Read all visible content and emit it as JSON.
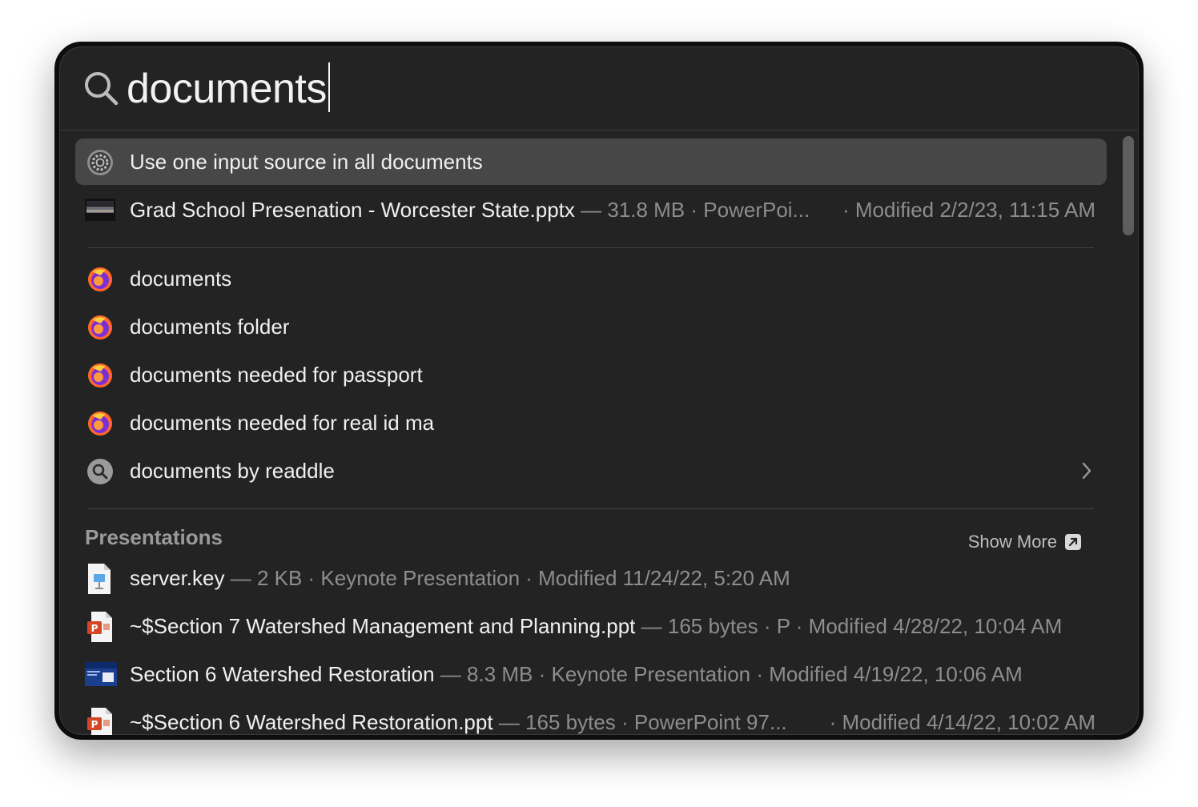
{
  "search": {
    "query": "documents"
  },
  "top_hits": [
    {
      "title": "Use one input source in all documents",
      "icon": "system-settings-gear-icon",
      "selected": true
    },
    {
      "title": "Grad School Presenation - Worcester State.pptx",
      "meta": " — 31.8 MB · PowerPoi...",
      "meta_right": "· Modified 2/2/23, 11:15 AM",
      "icon": "slide-thumbnail-icon"
    }
  ],
  "suggestions": [
    {
      "title": "documents",
      "icon": "firefox-icon"
    },
    {
      "title": "documents folder",
      "icon": "firefox-icon"
    },
    {
      "title": "documents needed for passport",
      "icon": "firefox-icon"
    },
    {
      "title": "documents needed for real id ma",
      "icon": "firefox-icon"
    },
    {
      "title": "documents by readdle",
      "icon": "search-icon",
      "has_chevron": true
    }
  ],
  "presentations": {
    "header": "Presentations",
    "show_more": "Show More",
    "items": [
      {
        "title": "server.key",
        "meta": " — 2 KB · Keynote Presentation · Modified 11/24/22, 5:20 AM",
        "icon": "keynote-file-icon"
      },
      {
        "title": "~$Section 7 Watershed Management and Planning.ppt",
        "meta": " — 165 bytes · P · Modified 4/28/22, 10:04 AM",
        "icon": "powerpoint-file-icon"
      },
      {
        "title": "Section 6 Watershed Restoration",
        "meta": " — 8.3 MB · Keynote Presentation · Modified 4/19/22, 10:06 AM",
        "icon": "slide-thumbnail-blue-icon"
      },
      {
        "title": "~$Section 6 Watershed Restoration.ppt",
        "meta": " — 165 bytes · PowerPoint 97...",
        "meta_right": "· Modified 4/14/22, 10:02 AM",
        "icon": "powerpoint-file-icon"
      }
    ]
  },
  "colors": {
    "panel": "#232323",
    "selected_row": "#474747",
    "text": "#f0f0f0",
    "muted": "#8d8d8d"
  }
}
